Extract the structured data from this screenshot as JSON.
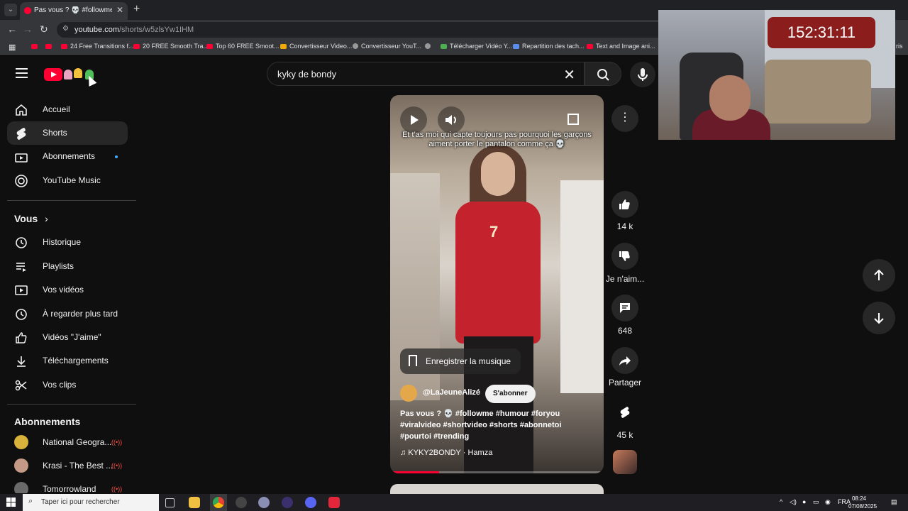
{
  "browser": {
    "tab_title": "Pas vous ? 💀 #followme #h",
    "url_host": "youtube.com",
    "url_path": "/shorts/w5zlsYw1IHM",
    "bookmarks": [
      "24 Free Transitions f...",
      "20 FREE Smooth Tra...",
      "Top 60 FREE Smoot...",
      "Convertisseur Video...",
      "Convertisseur YouT...",
      "Télécharger Vidéo Y...",
      "Repartition des tach...",
      "Text and Image ani..."
    ],
    "bookmarks_overflow": "ris"
  },
  "search": {
    "query": "kyky de bondy"
  },
  "sidebar": {
    "main": [
      {
        "label": "Accueil",
        "icon": "home-icon"
      },
      {
        "label": "Shorts",
        "icon": "shorts-icon"
      },
      {
        "label": "Abonnements",
        "icon": "subscriptions-icon"
      },
      {
        "label": "YouTube Music",
        "icon": "music-icon"
      }
    ],
    "you_title": "Vous",
    "you": [
      {
        "label": "Historique",
        "icon": "history-icon"
      },
      {
        "label": "Playlists",
        "icon": "playlists-icon"
      },
      {
        "label": "Vos vidéos",
        "icon": "your-videos-icon"
      },
      {
        "label": "À regarder plus tard",
        "icon": "watch-later-icon"
      },
      {
        "label": "Vidéos \"J'aime\"",
        "icon": "liked-icon"
      },
      {
        "label": "Téléchargements",
        "icon": "download-icon"
      },
      {
        "label": "Vos clips",
        "icon": "clips-icon"
      }
    ],
    "subs_title": "Abonnements",
    "subs": [
      {
        "label": "National Geogra...",
        "live": "((•))"
      },
      {
        "label": "Krasi - The Best ...",
        "live": "((•))"
      },
      {
        "label": "Tomorrowland",
        "live": "((•))"
      }
    ]
  },
  "short": {
    "overlay_caption": "Et t'as moi qui capte toujours pas pourquoi les garçons aiment porter le pantalon comme ça 💀",
    "shirt_number": "7",
    "save_music": "Enregistrer la musique",
    "channel": "@LaJeuneAlizé",
    "subscribe": "S'abonner",
    "description": "Pas vous ? 💀 #followme #humour #foryou #viralvideo #shortvideo #shorts #abonnetoi #pourtoi #trending",
    "music": "♫ KYKY2BONDY · Hamza",
    "progress": 0.23
  },
  "actions": {
    "likes": "14 k",
    "dislike": "Je n'aim...",
    "comments": "648",
    "share": "Partager",
    "remix": "45 k"
  },
  "webcam": {
    "timer": "152:31:11"
  },
  "taskbar": {
    "search_placeholder": "Taper ici pour rechercher",
    "lang": "FRA",
    "time": "08:24",
    "date": "07/08/2025"
  }
}
